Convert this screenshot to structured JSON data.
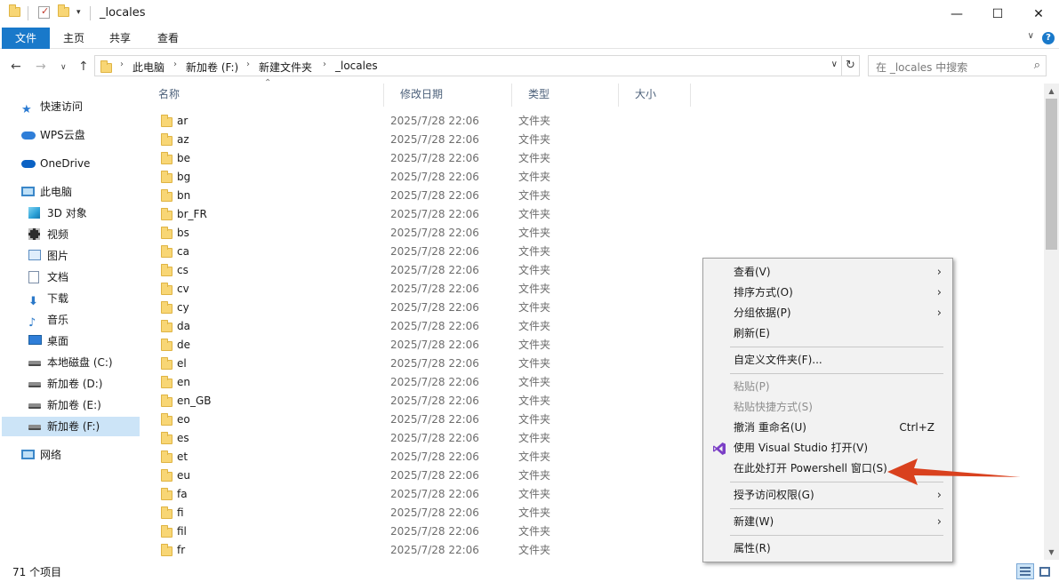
{
  "window": {
    "title": "_locales",
    "minimize": "—",
    "maximize": "☐",
    "close": "✕"
  },
  "ribbon": {
    "tabs": [
      "文件",
      "主页",
      "共享",
      "查看"
    ],
    "help": "?",
    "collapse": "∨"
  },
  "address": {
    "crumbs": [
      "此电脑",
      "新加卷 (F:)",
      "新建文件夹",
      "_locales"
    ],
    "dropdown": "∨",
    "refresh": "↻"
  },
  "search": {
    "placeholder": "在 _locales 中搜索",
    "icon": "search-icon"
  },
  "sidebar": {
    "items": [
      {
        "label": "快速访问",
        "icon": "star-icon"
      },
      {
        "label": "WPS云盘",
        "icon": "cloud-icon"
      },
      {
        "label": "OneDrive",
        "icon": "onedrive-icon"
      },
      {
        "label": "此电脑",
        "icon": "pc-icon"
      },
      {
        "label": "3D 对象",
        "icon": "cube-icon"
      },
      {
        "label": "视频",
        "icon": "film-icon"
      },
      {
        "label": "图片",
        "icon": "picture-icon"
      },
      {
        "label": "文档",
        "icon": "document-icon"
      },
      {
        "label": "下载",
        "icon": "download-icon"
      },
      {
        "label": "音乐",
        "icon": "music-icon"
      },
      {
        "label": "桌面",
        "icon": "desktop-icon"
      },
      {
        "label": "本地磁盘 (C:)",
        "icon": "drive-icon"
      },
      {
        "label": "新加卷 (D:)",
        "icon": "drive-icon"
      },
      {
        "label": "新加卷 (E:)",
        "icon": "drive-icon"
      },
      {
        "label": "新加卷 (F:)",
        "icon": "drive-icon",
        "selected": true
      },
      {
        "label": "网络",
        "icon": "network-icon"
      }
    ]
  },
  "columns": [
    "名称",
    "修改日期",
    "类型",
    "大小"
  ],
  "files": [
    {
      "name": "ar",
      "date": "2025/7/28 22:06",
      "type": "文件夹"
    },
    {
      "name": "az",
      "date": "2025/7/28 22:06",
      "type": "文件夹"
    },
    {
      "name": "be",
      "date": "2025/7/28 22:06",
      "type": "文件夹"
    },
    {
      "name": "bg",
      "date": "2025/7/28 22:06",
      "type": "文件夹"
    },
    {
      "name": "bn",
      "date": "2025/7/28 22:06",
      "type": "文件夹"
    },
    {
      "name": "br_FR",
      "date": "2025/7/28 22:06",
      "type": "文件夹"
    },
    {
      "name": "bs",
      "date": "2025/7/28 22:06",
      "type": "文件夹"
    },
    {
      "name": "ca",
      "date": "2025/7/28 22:06",
      "type": "文件夹"
    },
    {
      "name": "cs",
      "date": "2025/7/28 22:06",
      "type": "文件夹"
    },
    {
      "name": "cv",
      "date": "2025/7/28 22:06",
      "type": "文件夹"
    },
    {
      "name": "cy",
      "date": "2025/7/28 22:06",
      "type": "文件夹"
    },
    {
      "name": "da",
      "date": "2025/7/28 22:06",
      "type": "文件夹"
    },
    {
      "name": "de",
      "date": "2025/7/28 22:06",
      "type": "文件夹"
    },
    {
      "name": "el",
      "date": "2025/7/28 22:06",
      "type": "文件夹"
    },
    {
      "name": "en",
      "date": "2025/7/28 22:06",
      "type": "文件夹"
    },
    {
      "name": "en_GB",
      "date": "2025/7/28 22:06",
      "type": "文件夹"
    },
    {
      "name": "eo",
      "date": "2025/7/28 22:06",
      "type": "文件夹"
    },
    {
      "name": "es",
      "date": "2025/7/28 22:06",
      "type": "文件夹"
    },
    {
      "name": "et",
      "date": "2025/7/28 22:06",
      "type": "文件夹"
    },
    {
      "name": "eu",
      "date": "2025/7/28 22:06",
      "type": "文件夹"
    },
    {
      "name": "fa",
      "date": "2025/7/28 22:06",
      "type": "文件夹"
    },
    {
      "name": "fi",
      "date": "2025/7/28 22:06",
      "type": "文件夹"
    },
    {
      "name": "fil",
      "date": "2025/7/28 22:06",
      "type": "文件夹"
    },
    {
      "name": "fr",
      "date": "2025/7/28 22:06",
      "type": "文件夹"
    }
  ],
  "status": {
    "count": "71 个项目"
  },
  "context_menu": {
    "items": [
      {
        "label": "查看(V)",
        "submenu": true
      },
      {
        "label": "排序方式(O)",
        "submenu": true
      },
      {
        "label": "分组依据(P)",
        "submenu": true
      },
      {
        "label": "刷新(E)"
      },
      {
        "label": "自定义文件夹(F)..."
      },
      {
        "label": "粘贴(P)",
        "disabled": true
      },
      {
        "label": "粘贴快捷方式(S)",
        "disabled": true
      },
      {
        "label": "撤消 重命名(U)",
        "shortcut": "Ctrl+Z"
      },
      {
        "label": "使用 Visual Studio 打开(V)",
        "icon": "visual-studio-icon"
      },
      {
        "label": "在此处打开 Powershell 窗口(S)"
      },
      {
        "label": "授予访问权限(G)",
        "submenu": true
      },
      {
        "label": "新建(W)",
        "submenu": true
      },
      {
        "label": "属性(R)"
      }
    ],
    "submenu_glyph": "›"
  },
  "colors": {
    "accent": "#1979ca",
    "selection": "#cce4f7",
    "folder": "#f8d675",
    "annotation_arrow": "#d9411e"
  }
}
